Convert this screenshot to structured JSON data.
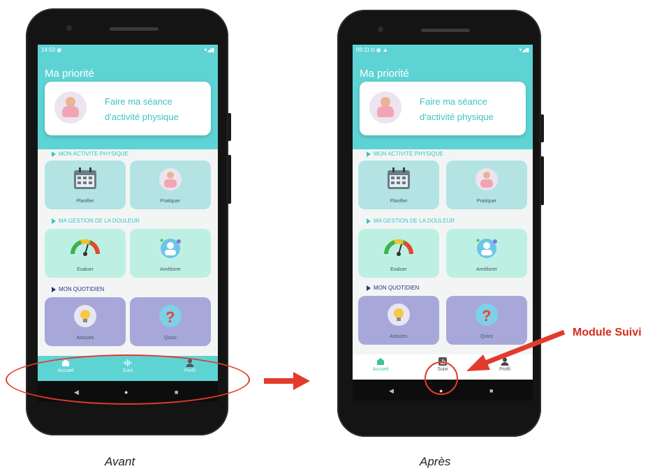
{
  "colors": {
    "teal": "#5ed3d4",
    "teal_text": "#3cc3c4",
    "tile_teal": "#b4e3e4",
    "tile_mint": "#bdf0e3",
    "tile_lavender": "#a7a7d9",
    "annotation_red": "#d62b1c",
    "section_teal": "#3cc3c4",
    "section_navy": "#27328a"
  },
  "before": {
    "status_time": "14:50",
    "app_title": "Ma priorité",
    "priority_text": "Faire ma séance d'activité physique",
    "sections": {
      "activity": "MON ACTIVITE PHYSIQUE",
      "pain": "MA GESTION DE LA DOULEUR",
      "daily": "MON QUOTIDIEN"
    },
    "tiles": {
      "plan": "Planifier",
      "practice": "Pratiquer",
      "evaluate": "Evaluer",
      "improve": "Améliorer",
      "tips": "Astuces",
      "quiz": "Quizz"
    },
    "nav": {
      "home": "Accueil",
      "track": "Suivi",
      "profile": "Profil"
    }
  },
  "after": {
    "status_time": "09:11",
    "app_title": "Ma priorité",
    "priority_text": "Faire ma séance d'activité physique",
    "sections": {
      "activity": "MON ACTIVITE PHYSIQUE",
      "pain": "MA GESTION DE LA DOULEUR",
      "daily": "MON QUOTIDIEN"
    },
    "tiles": {
      "plan": "Planifier",
      "practice": "Pratiquer",
      "evaluate": "Evaluer",
      "improve": "Améliorer",
      "tips": "Astuces",
      "quiz": "Quizz"
    },
    "nav": {
      "home": "Accueil",
      "track": "Suivi",
      "profile": "Profil"
    }
  },
  "captions": {
    "before": "Avant",
    "after": "Après"
  },
  "annotation": {
    "label": "Module Suivi"
  }
}
